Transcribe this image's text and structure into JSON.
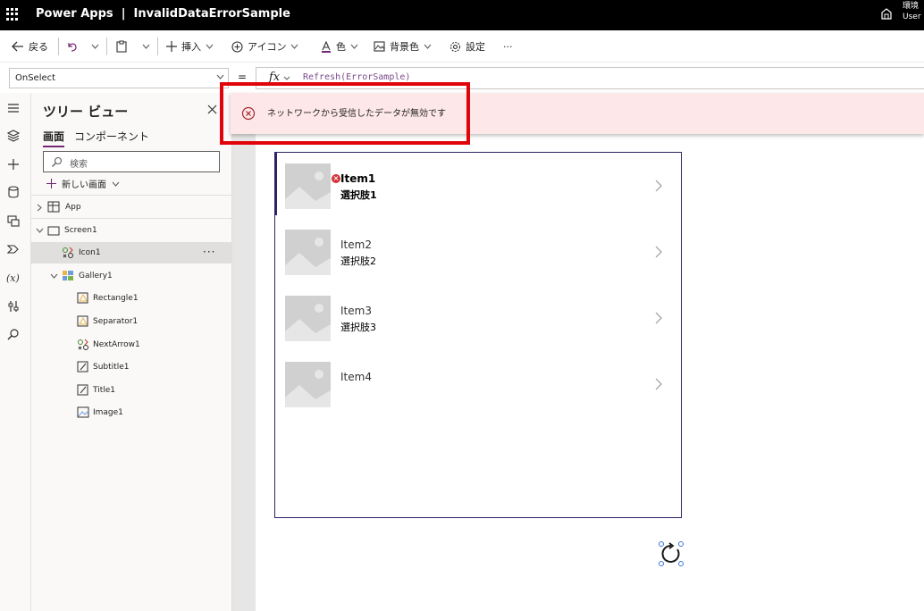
{
  "app": {
    "name": "Power Apps",
    "separator": "|",
    "title": "InvalidDataErrorSample",
    "env_line1": "環境",
    "env_line2": "User"
  },
  "toolbar": {
    "back": "戻る",
    "insert": "挿入",
    "icon": "アイコン",
    "color": "色",
    "background": "背景色",
    "settings": "設定",
    "more": "···"
  },
  "formula": {
    "property": "OnSelect",
    "equals": "=",
    "fx": "fx",
    "expression": "Refresh(ErrorSample)"
  },
  "tree": {
    "title": "ツリー ビュー",
    "tabs": [
      "画面",
      "コンポーネント"
    ],
    "search_placeholder": "検索",
    "new_screen": "新しい画面",
    "nodes": [
      "App",
      "Screen1",
      "Icon1",
      "Gallery1",
      "Rectangle1",
      "Separator1",
      "NextArrow1",
      "Subtitle1",
      "Title1",
      "Image1"
    ],
    "more": "···"
  },
  "gallery": {
    "items": [
      {
        "title": "Item1",
        "subtitle": "選択肢1"
      },
      {
        "title": "Item2",
        "subtitle": "選択肢2"
      },
      {
        "title": "Item3",
        "subtitle": "選択肢3"
      },
      {
        "title": "Item4",
        "subtitle": ""
      }
    ]
  },
  "error": {
    "message": "ネットワークから受信したデータが無効です",
    "badge": "×"
  },
  "colors": {
    "accent": "#742774",
    "error": "#d13438",
    "highlight": "#e0050a",
    "gallery_border": "#2b2466"
  }
}
